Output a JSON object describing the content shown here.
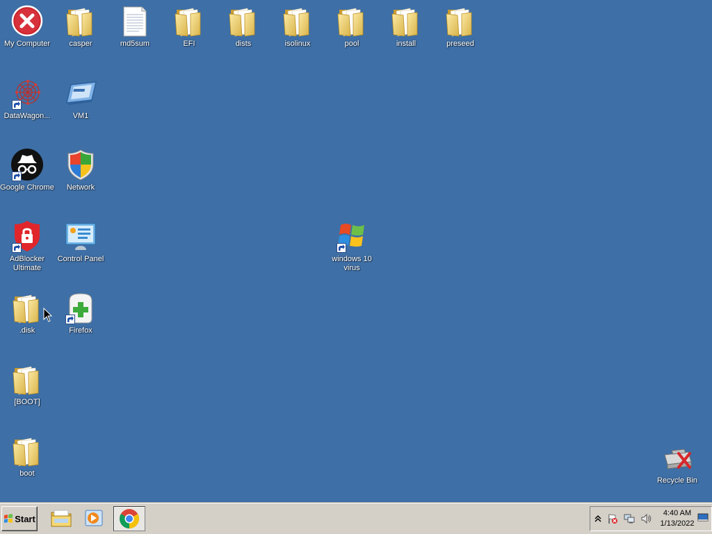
{
  "desktop": {
    "icons": {
      "my_computer": "My Computer",
      "casper": "casper",
      "md5sum": "md5sum",
      "efi": "EFI",
      "dists": "dists",
      "isolinux": "isolinux",
      "pool": "pool",
      "install": "install",
      "preseed": "preseed",
      "datawagon": "DataWagon...",
      "vm1": "VM1",
      "google_chrome": "Google Chrome",
      "network": "Network",
      "adblocker": "AdBlocker Ultimate",
      "control_panel": "Control Panel",
      "windows10": "windows 10 virus",
      "disk": ".disk",
      "firefox": "Firefox",
      "boot_bracket": "[BOOT]",
      "boot": "boot",
      "recycle_bin": "Recycle Bin"
    }
  },
  "taskbar": {
    "start_label": "Start",
    "clock_time": "4:40 AM",
    "clock_date": "1/13/2022",
    "pinned": [
      "folder-icon",
      "media-player-icon",
      "chrome-icon"
    ]
  },
  "colors": {
    "desktop": "#3e6fa6",
    "taskbar": "#d4d0c8",
    "folder": "#f2d46b"
  }
}
